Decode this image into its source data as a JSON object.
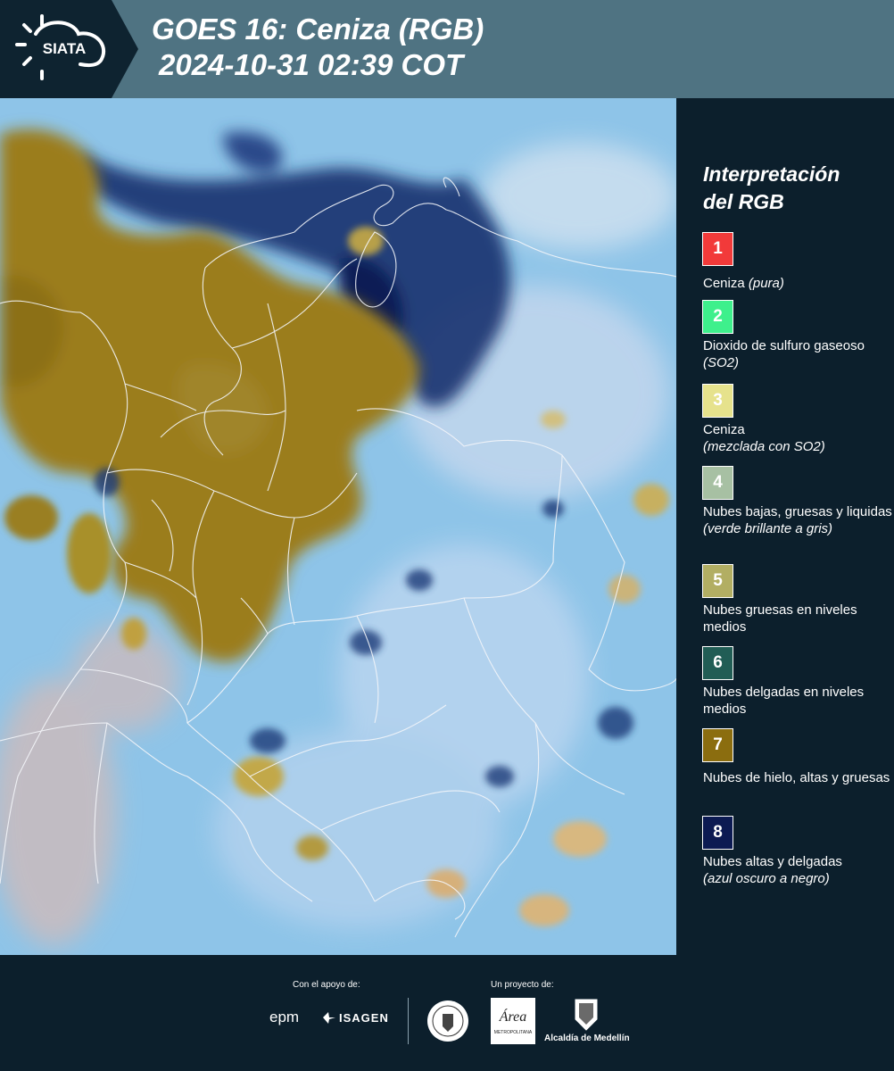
{
  "header": {
    "brand": "SIATA",
    "title_line1": "GOES 16: Ceniza (RGB)",
    "title_line2": "2024-10-31 02:39 COT"
  },
  "legend": {
    "title_line1": "Interpretación",
    "title_line2": "del RGB",
    "items": [
      {
        "number": "1",
        "color": "#f23a3a",
        "text": "Ceniza",
        "italic": "(pura)"
      },
      {
        "number": "2",
        "color": "#3ef08c",
        "text": "Dioxido de sulfuro gaseoso",
        "italic": "(SO2)"
      },
      {
        "number": "3",
        "color": "#e6e28c",
        "text": "Ceniza",
        "italic": "(mezclada con SO2)"
      },
      {
        "number": "4",
        "color": "#a7c0a3",
        "text": "Nubes bajas, gruesas y liquidas",
        "italic": "(verde brillante a gris)"
      },
      {
        "number": "5",
        "color": "#b2ae63",
        "text": "Nubes gruesas en niveles medios",
        "italic": ""
      },
      {
        "number": "6",
        "color": "#215d55",
        "text": "Nubes delgadas en niveles medios",
        "italic": ""
      },
      {
        "number": "7",
        "color": "#8b6d0f",
        "text": "Nubes de hielo, altas y gruesas",
        "italic": ""
      },
      {
        "number": "8",
        "color": "#0c1a52",
        "text": "Nubes altas y delgadas",
        "italic": "(azul oscuro a negro)"
      }
    ]
  },
  "footer": {
    "support_label": "Con el apoyo de:",
    "project_label": "Un proyecto de:",
    "sponsor_1": "epm",
    "sponsor_2": "ISAGEN",
    "partner_area": "Área",
    "partner_area_sub": "METROPOLITANA",
    "partner_alcaldia": "Alcaldía de Medellín"
  }
}
